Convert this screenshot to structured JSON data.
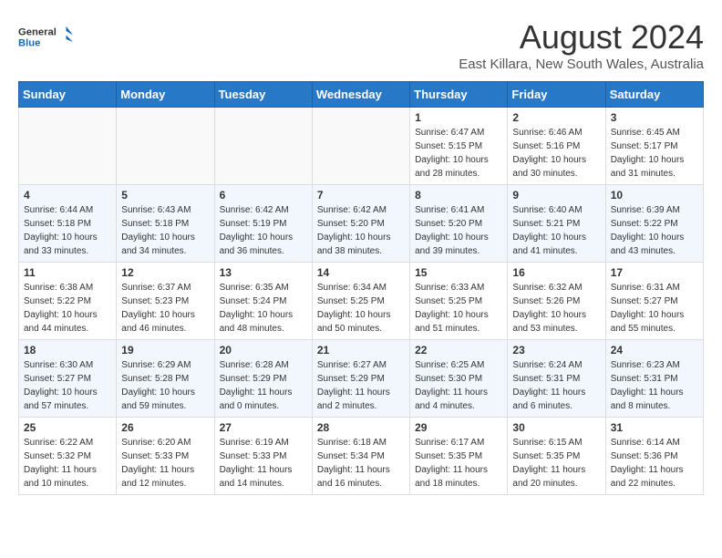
{
  "header": {
    "logo_line1": "General",
    "logo_line2": "Blue",
    "month": "August 2024",
    "location": "East Killara, New South Wales, Australia"
  },
  "weekdays": [
    "Sunday",
    "Monday",
    "Tuesday",
    "Wednesday",
    "Thursday",
    "Friday",
    "Saturday"
  ],
  "weeks": [
    [
      {
        "day": "",
        "info": ""
      },
      {
        "day": "",
        "info": ""
      },
      {
        "day": "",
        "info": ""
      },
      {
        "day": "",
        "info": ""
      },
      {
        "day": "1",
        "info": "Sunrise: 6:47 AM\nSunset: 5:15 PM\nDaylight: 10 hours\nand 28 minutes."
      },
      {
        "day": "2",
        "info": "Sunrise: 6:46 AM\nSunset: 5:16 PM\nDaylight: 10 hours\nand 30 minutes."
      },
      {
        "day": "3",
        "info": "Sunrise: 6:45 AM\nSunset: 5:17 PM\nDaylight: 10 hours\nand 31 minutes."
      }
    ],
    [
      {
        "day": "4",
        "info": "Sunrise: 6:44 AM\nSunset: 5:18 PM\nDaylight: 10 hours\nand 33 minutes."
      },
      {
        "day": "5",
        "info": "Sunrise: 6:43 AM\nSunset: 5:18 PM\nDaylight: 10 hours\nand 34 minutes."
      },
      {
        "day": "6",
        "info": "Sunrise: 6:42 AM\nSunset: 5:19 PM\nDaylight: 10 hours\nand 36 minutes."
      },
      {
        "day": "7",
        "info": "Sunrise: 6:42 AM\nSunset: 5:20 PM\nDaylight: 10 hours\nand 38 minutes."
      },
      {
        "day": "8",
        "info": "Sunrise: 6:41 AM\nSunset: 5:20 PM\nDaylight: 10 hours\nand 39 minutes."
      },
      {
        "day": "9",
        "info": "Sunrise: 6:40 AM\nSunset: 5:21 PM\nDaylight: 10 hours\nand 41 minutes."
      },
      {
        "day": "10",
        "info": "Sunrise: 6:39 AM\nSunset: 5:22 PM\nDaylight: 10 hours\nand 43 minutes."
      }
    ],
    [
      {
        "day": "11",
        "info": "Sunrise: 6:38 AM\nSunset: 5:22 PM\nDaylight: 10 hours\nand 44 minutes."
      },
      {
        "day": "12",
        "info": "Sunrise: 6:37 AM\nSunset: 5:23 PM\nDaylight: 10 hours\nand 46 minutes."
      },
      {
        "day": "13",
        "info": "Sunrise: 6:35 AM\nSunset: 5:24 PM\nDaylight: 10 hours\nand 48 minutes."
      },
      {
        "day": "14",
        "info": "Sunrise: 6:34 AM\nSunset: 5:25 PM\nDaylight: 10 hours\nand 50 minutes."
      },
      {
        "day": "15",
        "info": "Sunrise: 6:33 AM\nSunset: 5:25 PM\nDaylight: 10 hours\nand 51 minutes."
      },
      {
        "day": "16",
        "info": "Sunrise: 6:32 AM\nSunset: 5:26 PM\nDaylight: 10 hours\nand 53 minutes."
      },
      {
        "day": "17",
        "info": "Sunrise: 6:31 AM\nSunset: 5:27 PM\nDaylight: 10 hours\nand 55 minutes."
      }
    ],
    [
      {
        "day": "18",
        "info": "Sunrise: 6:30 AM\nSunset: 5:27 PM\nDaylight: 10 hours\nand 57 minutes."
      },
      {
        "day": "19",
        "info": "Sunrise: 6:29 AM\nSunset: 5:28 PM\nDaylight: 10 hours\nand 59 minutes."
      },
      {
        "day": "20",
        "info": "Sunrise: 6:28 AM\nSunset: 5:29 PM\nDaylight: 11 hours\nand 0 minutes."
      },
      {
        "day": "21",
        "info": "Sunrise: 6:27 AM\nSunset: 5:29 PM\nDaylight: 11 hours\nand 2 minutes."
      },
      {
        "day": "22",
        "info": "Sunrise: 6:25 AM\nSunset: 5:30 PM\nDaylight: 11 hours\nand 4 minutes."
      },
      {
        "day": "23",
        "info": "Sunrise: 6:24 AM\nSunset: 5:31 PM\nDaylight: 11 hours\nand 6 minutes."
      },
      {
        "day": "24",
        "info": "Sunrise: 6:23 AM\nSunset: 5:31 PM\nDaylight: 11 hours\nand 8 minutes."
      }
    ],
    [
      {
        "day": "25",
        "info": "Sunrise: 6:22 AM\nSunset: 5:32 PM\nDaylight: 11 hours\nand 10 minutes."
      },
      {
        "day": "26",
        "info": "Sunrise: 6:20 AM\nSunset: 5:33 PM\nDaylight: 11 hours\nand 12 minutes."
      },
      {
        "day": "27",
        "info": "Sunrise: 6:19 AM\nSunset: 5:33 PM\nDaylight: 11 hours\nand 14 minutes."
      },
      {
        "day": "28",
        "info": "Sunrise: 6:18 AM\nSunset: 5:34 PM\nDaylight: 11 hours\nand 16 minutes."
      },
      {
        "day": "29",
        "info": "Sunrise: 6:17 AM\nSunset: 5:35 PM\nDaylight: 11 hours\nand 18 minutes."
      },
      {
        "day": "30",
        "info": "Sunrise: 6:15 AM\nSunset: 5:35 PM\nDaylight: 11 hours\nand 20 minutes."
      },
      {
        "day": "31",
        "info": "Sunrise: 6:14 AM\nSunset: 5:36 PM\nDaylight: 11 hours\nand 22 minutes."
      }
    ]
  ]
}
